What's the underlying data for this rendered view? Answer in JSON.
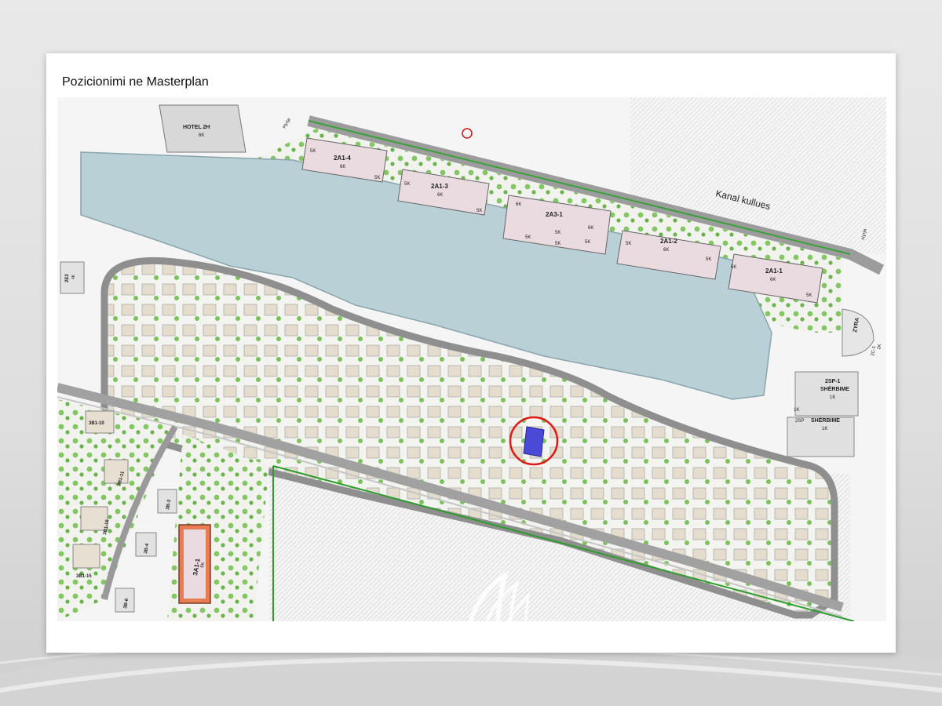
{
  "page": {
    "title": "Pozicionimi ne Masterplan"
  },
  "map": {
    "canal_label": "Kanal kullues",
    "entrances": [
      "Hyrja",
      "Hyrja"
    ],
    "top_buildings": [
      {
        "code": "HOTEL 2H",
        "floors": "6K"
      },
      {
        "code": "2A1-4",
        "floors": "6K",
        "side_left": "5K",
        "side_right": "5K"
      },
      {
        "code": "2A1-3",
        "floors": "6K",
        "side_left": "5K",
        "side_right": "5K"
      },
      {
        "code": "2A3-1",
        "floors": "6K",
        "left": "6K",
        "right": "6K",
        "bottom_left": "5K",
        "bottom_mid": "5K",
        "bottom_right": "5K",
        "far_left": "5K"
      },
      {
        "code": "2A1-2",
        "floors": "6K",
        "side_left": "5K",
        "side_right": "5K"
      },
      {
        "code": "2A1-1",
        "floors": "6K",
        "side_left": "5K",
        "side_right": "5K"
      }
    ],
    "right_buildings": [
      {
        "code": "ZYRA"
      },
      {
        "code": "2C-1",
        "floors": "1K"
      },
      {
        "code": "2SP-1",
        "name": "SHËRBIME",
        "floors": "1K"
      },
      {
        "code": "2SP",
        "name": "SHËRBIME",
        "floors": "1K",
        "side": "1K"
      }
    ],
    "left_buildings": [
      {
        "code": "2E2",
        "floors": "4K"
      },
      {
        "code": "3B1-10"
      },
      {
        "code": "3B1-11"
      },
      {
        "code": "3B1-16"
      },
      {
        "code": "3B1-15"
      },
      {
        "code": "3B-3"
      },
      {
        "code": "3B-4"
      },
      {
        "code": "3B-6"
      },
      {
        "code": "3A1-1",
        "floors": "6K"
      }
    ],
    "highlight": "selected building"
  }
}
